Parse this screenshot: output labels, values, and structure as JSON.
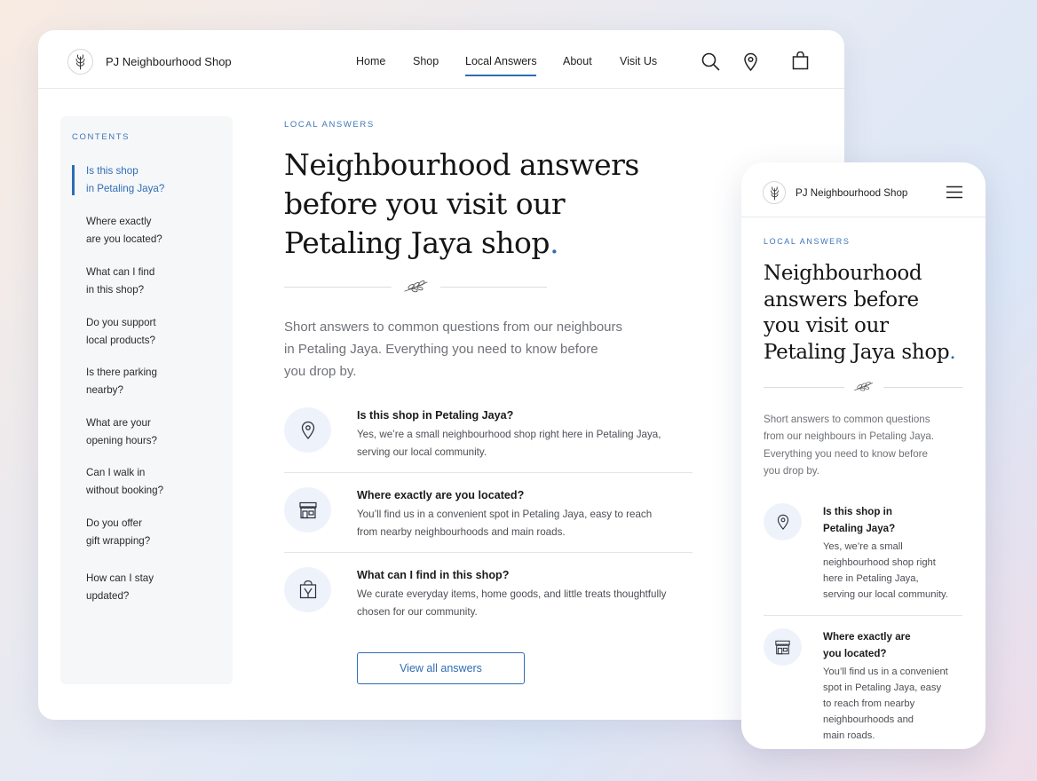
{
  "site": {
    "brand": "PJ Neighbourhood Shop"
  },
  "nav": {
    "items": [
      {
        "label": "Home"
      },
      {
        "label": "Shop"
      },
      {
        "label": "Local Answers"
      },
      {
        "label": "About"
      },
      {
        "label": "Visit Us"
      }
    ],
    "active": "Local Answers"
  },
  "header_icons": [
    "search-icon",
    "location-pin-icon",
    "shopping-bag-icon"
  ],
  "toc": {
    "title": "CONTENTS",
    "items": [
      {
        "line1": "Is this shop",
        "line2": "in Petaling Jaya?"
      },
      {
        "line1": "Where exactly",
        "line2": "are you located?"
      },
      {
        "line1": "What can I find",
        "line2": "in this shop?"
      },
      {
        "line1": "Do you support",
        "line2": "local products?"
      },
      {
        "line1": "Is there parking",
        "line2": "nearby?"
      },
      {
        "line1": "What are your",
        "line2": "opening hours?"
      },
      {
        "line1": "Can I walk in",
        "line2": "without booking?"
      },
      {
        "line1": "Do you offer",
        "line2": "gift wrapping?"
      },
      {
        "line1": "How can I stay",
        "line2": "updated?"
      }
    ]
  },
  "main": {
    "eyebrow": "LOCAL ANSWERS",
    "headline": {
      "line1": "Neighbourhood answers",
      "line2": "before you visit our",
      "line3": "Petaling Jaya shop",
      "dot": "."
    },
    "intro": {
      "line1": "Short answers to common questions from our neighbours",
      "line2": "in Petaling Jaya. Everything you need to know before",
      "line3": "you drop by."
    },
    "faqs": [
      {
        "icon": "location-pin-icon",
        "question": "Is this shop in Petaling Jaya?",
        "answer_line1": "Yes, we’re a small neighbourhood shop right here in Petaling Jaya,",
        "answer_line2": "serving our local community."
      },
      {
        "icon": "storefront-icon",
        "question": "Where exactly are you located?",
        "answer_line1": "You’ll find us in a convenient spot in Petaling Jaya, easy to reach",
        "answer_line2": "from nearby neighbourhoods and main roads."
      },
      {
        "icon": "gift-bag-icon",
        "question": "What can I find in this shop?",
        "answer_line1": "We curate everyday items, home goods, and little treats thoughtfully",
        "answer_line2": "chosen for our community."
      }
    ],
    "view_all_button": "View all answers"
  },
  "mobile": {
    "brand": "PJ Neighbourhood Shop",
    "eyebrow": "LOCAL ANSWERS",
    "headline": {
      "line1": "Neighbourhood",
      "line2": "answers before",
      "line3": "you visit our",
      "line4": "Petaling Jaya shop",
      "dot": "."
    },
    "intro": {
      "line1": "Short answers to common questions",
      "line2": "from our neighbours in Petaling Jaya.",
      "line3": "Everything you need to know before",
      "line4": "you drop by."
    },
    "faqs": [
      {
        "q1": "Is this shop in",
        "q2": "Petaling Jaya?",
        "a1": "Yes, we’re a small",
        "a2": "neighbourhood shop right",
        "a3": "here in Petaling Jaya,",
        "a4": "serving our local community."
      },
      {
        "q1": "Where exactly are",
        "q2": "you located?",
        "a1": "You’ll find us in a convenient",
        "a2": "spot in Petaling Jaya, easy",
        "a3": "to reach from nearby",
        "a4": "neighbourhoods and",
        "a5": "main roads."
      }
    ]
  },
  "colors": {
    "accent": "#2f6db4",
    "icon_bg": "#eef3fb",
    "text": "#1b1b1b",
    "muted": "#6f7277"
  }
}
